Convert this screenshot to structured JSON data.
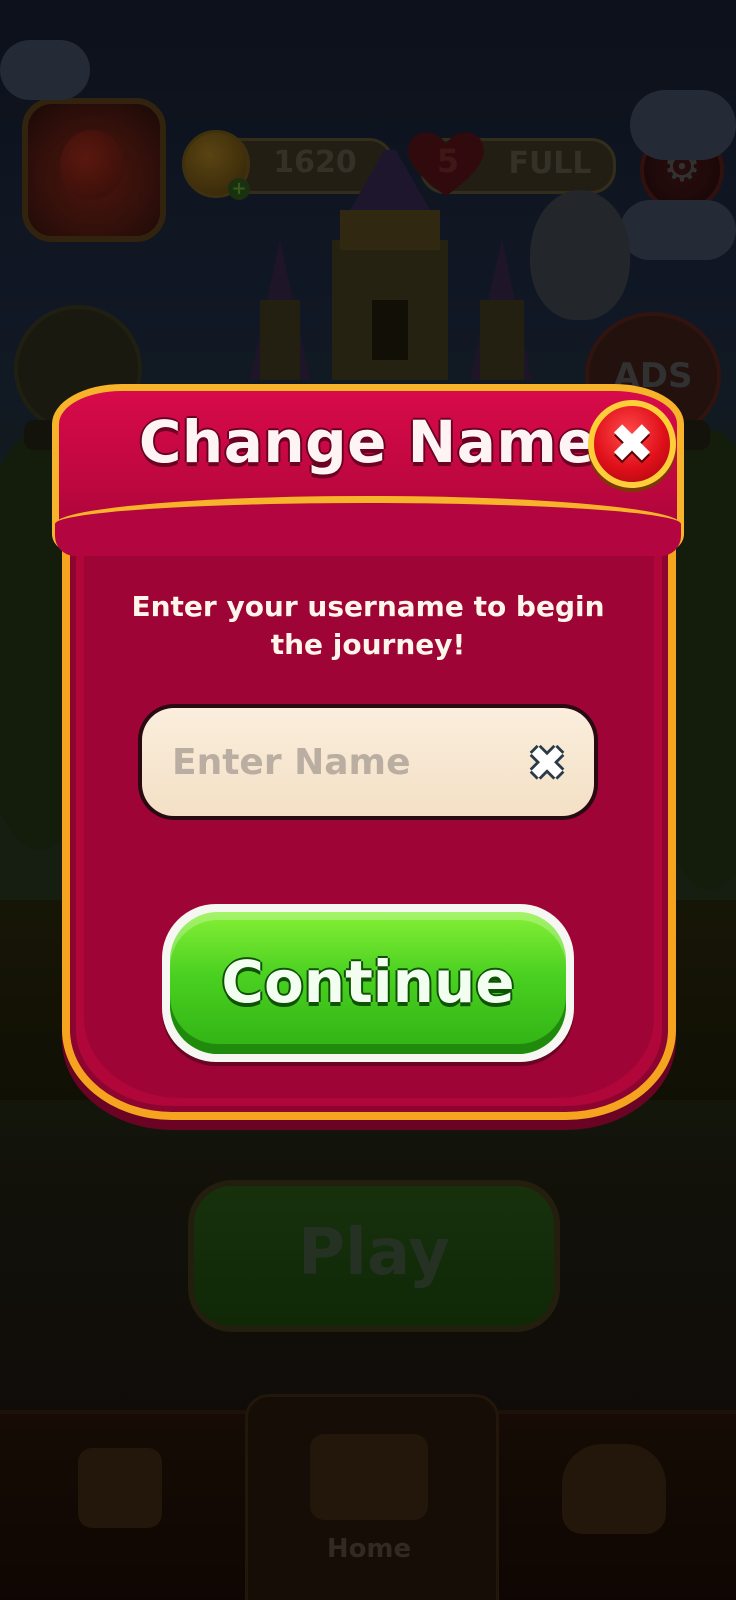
{
  "background": {
    "coins": "1620",
    "lives": "5",
    "lives_status": "FULL",
    "ads_label": "ADS",
    "play_label": "Play",
    "home_label": "Home",
    "icons": {
      "settings": "gear-icon",
      "coin": "coin-icon",
      "heart": "heart-icon",
      "add_coins": "plus-icon"
    }
  },
  "dialog": {
    "title": "Change Name",
    "instruction": "Enter your username to begin the journey!",
    "input_placeholder": "Enter Name",
    "input_value": "",
    "continue_label": "Continue",
    "close_icon": "close-icon",
    "clear_icon": "clear-icon"
  },
  "colors": {
    "dialog_primary": "#b0063a",
    "dialog_border": "#f5a41f",
    "continue_green": "#4ad021",
    "close_red": "#e0101a"
  }
}
